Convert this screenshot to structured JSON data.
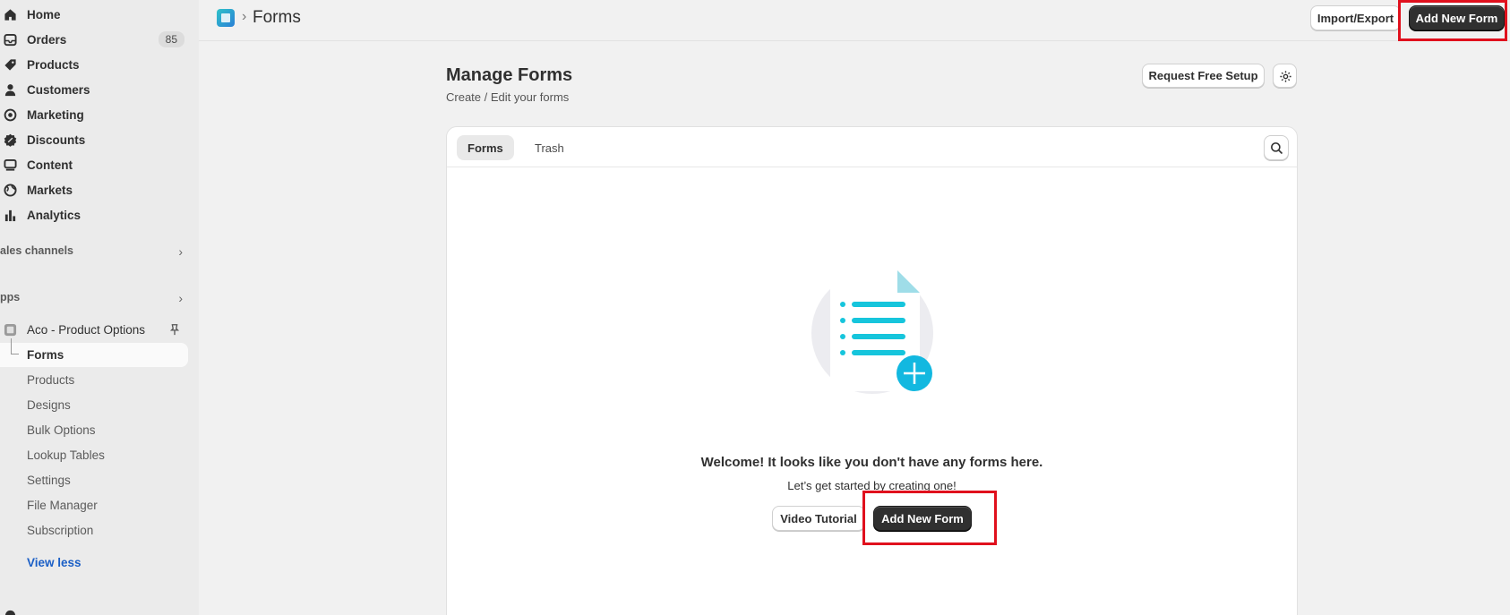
{
  "sidebar": {
    "items": [
      {
        "label": "Home",
        "icon": "home-icon"
      },
      {
        "label": "Orders",
        "icon": "orders-icon",
        "badge": "85"
      },
      {
        "label": "Products",
        "icon": "tag-icon"
      },
      {
        "label": "Customers",
        "icon": "person-icon"
      },
      {
        "label": "Marketing",
        "icon": "target-icon"
      },
      {
        "label": "Discounts",
        "icon": "discount-icon"
      },
      {
        "label": "Content",
        "icon": "content-icon"
      },
      {
        "label": "Markets",
        "icon": "globe-icon"
      },
      {
        "label": "Analytics",
        "icon": "bar-chart-icon"
      }
    ],
    "sales_channels": "ales channels",
    "apps": "pps",
    "app_name": "Aco - Product Options",
    "app_subitems": [
      "Forms",
      "Products",
      "Designs",
      "Bulk Options",
      "Lookup Tables",
      "Settings",
      "File Manager",
      "Subscription"
    ],
    "view_less": "View less"
  },
  "topbar": {
    "title": "Forms",
    "import_export": "Import/Export",
    "add_new_form": "Add New Form"
  },
  "page": {
    "title": "Manage Forms",
    "subtitle": "Create / Edit your forms",
    "request_setup": "Request Free Setup"
  },
  "card": {
    "tabs": [
      "Forms",
      "Trash"
    ],
    "empty_title": "Welcome! It looks like you don't have any forms here.",
    "empty_sub": "Let’s get started by creating one!",
    "video_tutorial": "Video Tutorial",
    "add_new_form": "Add New Form"
  },
  "colors": {
    "accent_red": "#e0101d",
    "primary_button": "#303030",
    "illustration_cyan": "#16c5dc"
  }
}
